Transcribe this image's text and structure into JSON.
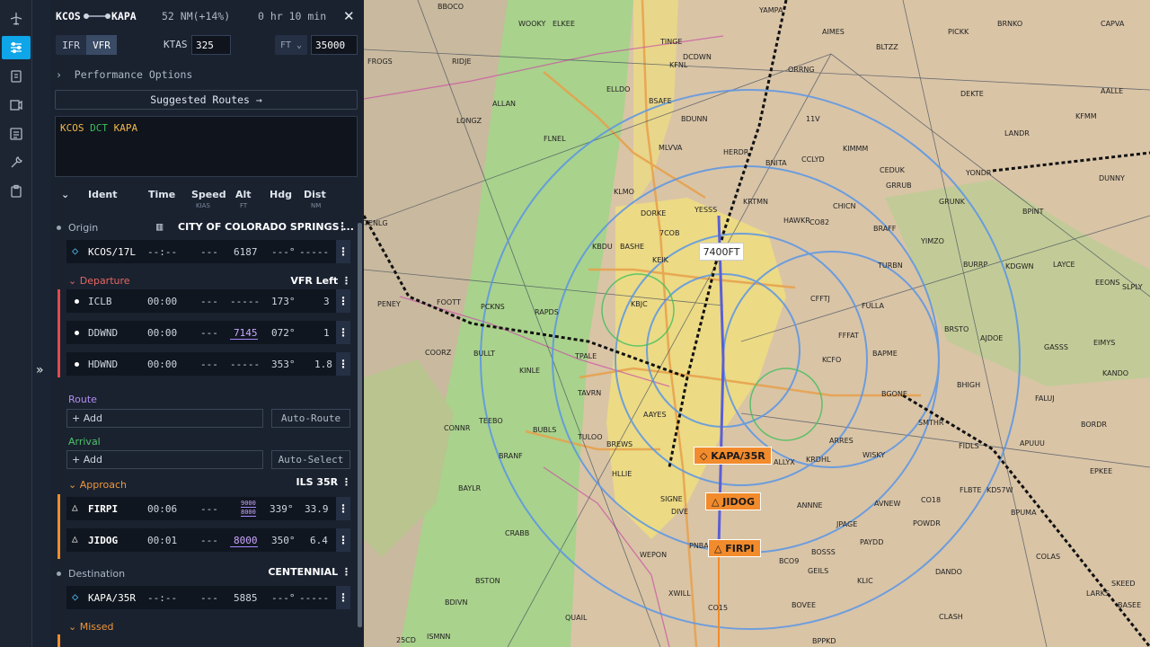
{
  "header": {
    "origin": "KCOS",
    "destination": "KAPA",
    "distance": "52 NM(+14%)",
    "ete": "0 hr 10 min",
    "close": "✕"
  },
  "settings": {
    "rules": [
      "IFR",
      "VFR"
    ],
    "active_rule": "VFR",
    "ktas_label": "KTAS",
    "ktas_value": "325",
    "alt_unit": "FT",
    "alt_value": "35000"
  },
  "performance_label": "Performance Options",
  "suggested_label": "Suggested Routes →",
  "route_string": {
    "origin": "KCOS",
    "via": "DCT",
    "dest": "KAPA"
  },
  "columns": {
    "ident": "Ident",
    "time": "Time",
    "speed": "Speed",
    "speed_unit": "KIAS",
    "alt": "Alt",
    "alt_unit": "FT",
    "hdg": "Hdg",
    "dist": "Dist",
    "dist_unit": "NM"
  },
  "origin_section": {
    "label": "Origin",
    "name": "CITY OF COLORADO SPRINGS ..."
  },
  "origin_row": {
    "ident": "KCOS/17L",
    "time": "--:--",
    "speed": "---",
    "alt": "6187",
    "hdg": "---°",
    "dist": "-----"
  },
  "departure": {
    "label": "Departure",
    "proc": "VFR Left"
  },
  "departure_rows": [
    {
      "ident": "ICLB",
      "time": "00:00",
      "speed": "---",
      "alt": "-----",
      "hdg": "173°",
      "dist": "3"
    },
    {
      "ident": "DDWND",
      "time": "00:00",
      "speed": "---",
      "alt": "7145",
      "hdg": "072°",
      "dist": "1"
    },
    {
      "ident": "HDWND",
      "time": "00:00",
      "speed": "---",
      "alt": "-----",
      "hdg": "353°",
      "dist": "1.8"
    }
  ],
  "route_section": {
    "label": "Route",
    "add": "+ Add",
    "auto": "Auto-Route"
  },
  "arrival_section": {
    "label": "Arrival",
    "add": "+ Add",
    "auto": "Auto-Select"
  },
  "approach": {
    "label": "Approach",
    "proc": "ILS 35R"
  },
  "approach_rows": [
    {
      "ident": "FIRPI",
      "time": "00:06",
      "speed": "---",
      "alt_top": "9000",
      "alt_bottom": "8000",
      "hdg": "339°",
      "dist": "33.9"
    },
    {
      "ident": "JIDOG",
      "time": "00:01",
      "speed": "---",
      "alt": "8000",
      "hdg": "350°",
      "dist": "6.4"
    }
  ],
  "destination_section": {
    "label": "Destination",
    "name": "CENTENNIAL"
  },
  "destination_row": {
    "ident": "KAPA/35R",
    "time": "--:--",
    "speed": "---",
    "alt": "5885",
    "hdg": "---°",
    "dist": "-----"
  },
  "missed": {
    "label": "Missed"
  },
  "map": {
    "altitude_flag": "7400FT",
    "waypoint_flags": [
      "KAPA/35R",
      "JIDOG",
      "FIRPI"
    ],
    "labels": [
      "BBOCO",
      "WOOKY",
      "ELKEE",
      "TINGE",
      "YAMPA",
      "AIMES",
      "BLTZZ",
      "PICKK",
      "BRNKO",
      "CAPVA",
      "FROGS",
      "RIDJE",
      "ELLDO",
      "KFNL",
      "DCDWN",
      "ORRNG",
      "DEKTE",
      "AALLE",
      "LONGZ",
      "ALLAN",
      "BSAFE",
      "BDUNN",
      "11V",
      "LANDR",
      "KFMM",
      "FLNEL",
      "MLVVA",
      "HERDR",
      "BNITA",
      "CCLYD",
      "KIMMM",
      "CEDUK",
      "YONDR",
      "DUNNY",
      "KLMO",
      "DORKE",
      "YESSS",
      "KRTMN",
      "GRRUB",
      "GRUNK",
      "BPINT",
      "HAWKR",
      "CO82",
      "CHICN",
      "BRAFF",
      "YIMZO",
      "TENLG",
      "KBDU",
      "BASHE",
      "7COB",
      "KEIK",
      "TURBN",
      "BURRP",
      "LAYCE",
      "EEONS",
      "SLPLY",
      "KDGWN",
      "PENEY",
      "FOOTT",
      "PCKNS",
      "RAPDS",
      "KBJC",
      "CFFTJ",
      "FULLA",
      "BRSTO",
      "AJDOE",
      "GASSS",
      "EIMYS",
      "KANDO",
      "COORZ",
      "BULLT",
      "TPALE",
      "KINLE",
      "KCFO",
      "FFFAT",
      "BAPME",
      "BHIGH",
      "TAVRN",
      "BGONE",
      "FALUJ",
      "BORDR",
      "TEEBO",
      "CONNR",
      "BUBLS",
      "AAYES",
      "SMTHR",
      "FIDLS",
      "APUUU",
      "TULOO",
      "BREWS",
      "ARRES",
      "BRANF",
      "HLLIE",
      "ALLYX",
      "KRDHL",
      "WISKY",
      "EPKEE",
      "BAYLR",
      "ANNNE",
      "AVNEW",
      "CO18",
      "FLBTE",
      "KD57W",
      "BPUMA",
      "SIGNE",
      "DIVE",
      "JPAGE",
      "POWDR",
      "CRABB",
      "PNBAL",
      "PAYDD",
      "WEPON",
      "BCO9",
      "BOSSS",
      "GEILS",
      "DANDO",
      "COLAS",
      "BSTON",
      "KLIC",
      "SKEED",
      "BDIVN",
      "XWILL",
      "CO15",
      "BOVEE",
      "LARKS",
      "QUAIL",
      "CLASH",
      "BASEE",
      "25CD",
      "ISMNN",
      "BPPKD"
    ]
  }
}
